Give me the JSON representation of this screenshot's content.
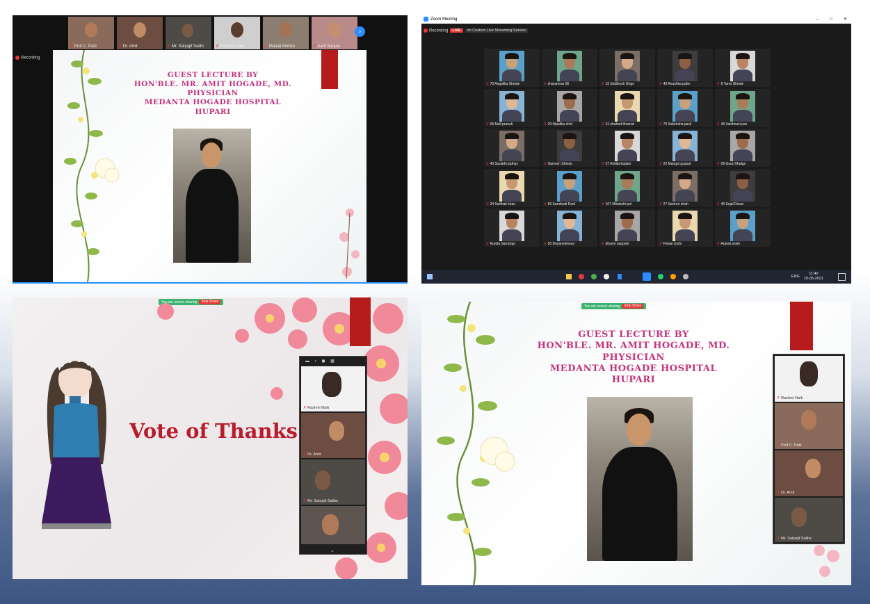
{
  "panel1": {
    "recording": "Recording",
    "top_participants": [
      "Prof C. Patil",
      "Dr. Amit",
      "Mr. Satyajit Salihi",
      "Rashmi Naik",
      "Manali Mohite",
      "Aarti Sanjay"
    ],
    "slide": {
      "line1": "GUEST LECTURE BY",
      "line2": "HON'BLE. MR. AMIT HOGADE, MD. PHYSICIAN",
      "line3": "MEDANTA HOGADE HOSPITAL",
      "line4": "HUPARI"
    }
  },
  "panel2": {
    "window_title": "Zoom Meeting",
    "recording": "Recording",
    "live": "LIVE",
    "stream_label": "on Custom Live Streaming Service",
    "window_controls": [
      "–",
      "□",
      "✕"
    ],
    "participants": [
      "70 Angolika Shinde",
      "sharanmar 80",
      "15 Siddhesh Ghge",
      "40 Anushka pahe",
      "6 Tanvi Shinde",
      "06 Mall pranali",
      "29 Dipalika shid",
      "31 shahad bhamat",
      "70 Sakshsha pack",
      "46 Vaishnavi pas",
      "40 Surabhi jadhav",
      "Sarvesh Shinde",
      "27 Ankita kadam",
      "22 Mangal gaspal",
      "09 Gauri Madge",
      "24 Sarthak khan",
      "66 Sanskrati Dodi",
      "107 Minakshi pol",
      "27 Saviree shah",
      "45 Sejal Desai",
      "Kunda Sarodrge",
      "55 Dnyaneshwari",
      "bhavni nagoshi",
      "Palvai Joshi",
      "Arandi ansle"
    ],
    "taskbar": {
      "time": "11:40",
      "date": "10-05-2021",
      "lang": "ENG"
    }
  },
  "panel3": {
    "share_bar": {
      "text": "You are screen sharing",
      "stop": "Stop Share"
    },
    "slide_title": "Vote of Thanks",
    "strip_participants": [
      "Rashmi Naik",
      "Dr. Amit",
      "Mr. Satyajit Salihe",
      ""
    ]
  },
  "panel4": {
    "share_bar": {
      "text": "You are screen sharing",
      "stop": "Stop Share"
    },
    "slide": {
      "line1": "GUEST LECTURE BY",
      "line2": "HON'BLE. MR. AMIT HOGADE, MD. PHYSICIAN",
      "line3": "MEDANTA HOGADE HOSPITAL",
      "line4": "HUPARI"
    },
    "strip_participants": [
      "Rashmi Naik",
      "Prof C. Patil",
      "Dr. Amit",
      "Mr. Satyajit Salihe"
    ]
  },
  "colors": {
    "slide_title": "#c2347d",
    "red_accent": "#b71c1c",
    "zoom_blue": "#2d8cff",
    "thanks_red": "#b91c2c"
  }
}
